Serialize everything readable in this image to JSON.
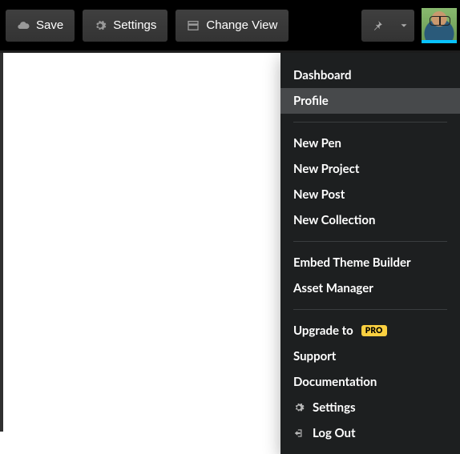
{
  "toolbar": {
    "save_label": "Save",
    "settings_label": "Settings",
    "change_view_label": "Change View"
  },
  "menu": {
    "group1": {
      "dashboard": "Dashboard",
      "profile": "Profile"
    },
    "group2": {
      "new_pen": "New Pen",
      "new_project": "New Project",
      "new_post": "New Post",
      "new_collection": "New Collection"
    },
    "group3": {
      "embed_theme_builder": "Embed Theme Builder",
      "asset_manager": "Asset Manager"
    },
    "group4": {
      "upgrade_to": "Upgrade to",
      "pro_badge": "PRO",
      "support": "Support",
      "documentation": "Documentation",
      "settings": "Settings",
      "log_out": "Log Out"
    }
  }
}
